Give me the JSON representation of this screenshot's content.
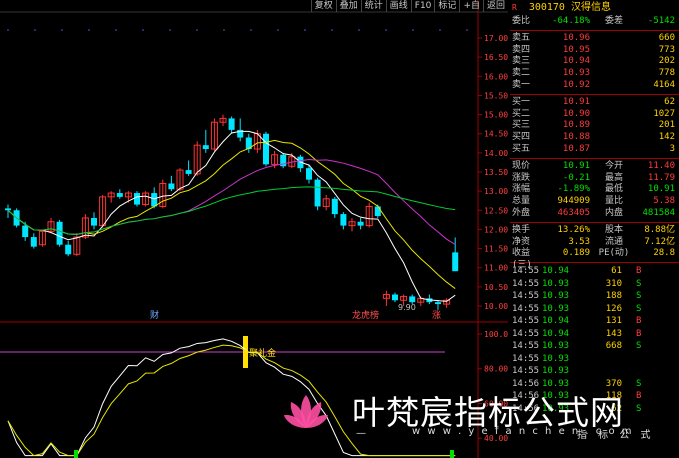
{
  "toolbar": [
    "复权",
    "叠加",
    "统计",
    "画线",
    "F10",
    "标记",
    "+自",
    "返回"
  ],
  "header": {
    "flag": "R",
    "code": "300170",
    "name": "汉得信息"
  },
  "order_book": {
    "webi": {
      "label": "委比",
      "value": "-64.18%",
      "label2": "委差",
      "value2": "-5142"
    },
    "asks": [
      {
        "label": "卖五",
        "price": "10.96",
        "vol": "660"
      },
      {
        "label": "卖四",
        "price": "10.95",
        "vol": "773"
      },
      {
        "label": "卖三",
        "price": "10.94",
        "vol": "202"
      },
      {
        "label": "卖二",
        "price": "10.93",
        "vol": "778"
      },
      {
        "label": "卖一",
        "price": "10.92",
        "vol": "4164"
      }
    ],
    "bids": [
      {
        "label": "买一",
        "price": "10.91",
        "vol": "62"
      },
      {
        "label": "买二",
        "price": "10.90",
        "vol": "1027"
      },
      {
        "label": "买三",
        "price": "10.89",
        "vol": "201"
      },
      {
        "label": "买四",
        "price": "10.88",
        "vol": "142"
      },
      {
        "label": "买五",
        "price": "10.87",
        "vol": "3"
      }
    ]
  },
  "stats": [
    {
      "l1": "现价",
      "v1": "10.91",
      "c1": "green",
      "l2": "今开",
      "v2": "11.40",
      "c2": "red"
    },
    {
      "l1": "涨跌",
      "v1": "-0.21",
      "c1": "green",
      "l2": "最高",
      "v2": "11.79",
      "c2": "red"
    },
    {
      "l1": "涨幅",
      "v1": "-1.89%",
      "c1": "green",
      "l2": "最低",
      "v2": "10.91",
      "c2": "green"
    },
    {
      "l1": "总量",
      "v1": "944909",
      "c1": "yel",
      "l2": "量比",
      "v2": "5.38",
      "c2": "red"
    },
    {
      "l1": "外盘",
      "v1": "463405",
      "c1": "red",
      "l2": "内盘",
      "v2": "481584",
      "c2": "green"
    }
  ],
  "fundamentals": [
    {
      "l1": "换手",
      "v1": "13.26%",
      "l2": "股本",
      "v2": "8.88亿"
    },
    {
      "l1": "净资",
      "v1": "3.53",
      "l2": "流通",
      "v2": "7.12亿"
    },
    {
      "l1": "收益(三)",
      "v1": "0.189",
      "l2": "PE(动)",
      "v2": "28.8"
    }
  ],
  "trades": [
    {
      "time": "14:55",
      "price": "10.94",
      "vol": "61",
      "bs": "B"
    },
    {
      "time": "14:55",
      "price": "10.93",
      "vol": "310",
      "bs": "S"
    },
    {
      "time": "14:55",
      "price": "10.93",
      "vol": "188",
      "bs": "S"
    },
    {
      "time": "14:55",
      "price": "10.93",
      "vol": "126",
      "bs": "S"
    },
    {
      "time": "14:55",
      "price": "10.94",
      "vol": "131",
      "bs": "B"
    },
    {
      "time": "14:55",
      "price": "10.94",
      "vol": "143",
      "bs": "B"
    },
    {
      "time": "14:55",
      "price": "10.93",
      "vol": "668",
      "bs": "S"
    },
    {
      "time": "14:55",
      "price": "10.93",
      "vol": "",
      "bs": ""
    },
    {
      "time": "14:55",
      "price": "10.93",
      "vol": "",
      "bs": ""
    },
    {
      "time": "14:56",
      "price": "10.93",
      "vol": "370",
      "bs": "S"
    },
    {
      "time": "14:56",
      "price": "10.93",
      "vol": "118",
      "bs": "B"
    },
    {
      "time": "14:56",
      "price": "10.93",
      "vol": "62",
      "bs": "S"
    }
  ],
  "chart_data": {
    "type": "candlestick",
    "price_axis_ticks": [
      "17.00",
      "16.50",
      "16.00",
      "15.50",
      "15.00",
      "14.50",
      "14.00",
      "13.50",
      "13.00",
      "12.50",
      "12.00",
      "11.50",
      "11.00",
      "10.50",
      "10.00"
    ],
    "ylim": [
      10.0,
      17.0
    ],
    "candles": [
      [
        12.55,
        12.65,
        12.3,
        12.5
      ],
      [
        12.5,
        12.55,
        12.05,
        12.1
      ],
      [
        12.1,
        12.2,
        11.7,
        11.8
      ],
      [
        11.8,
        11.9,
        11.5,
        11.55
      ],
      [
        11.6,
        12.0,
        11.55,
        11.95
      ],
      [
        11.95,
        12.3,
        11.9,
        12.2
      ],
      [
        12.2,
        12.25,
        11.55,
        11.6
      ],
      [
        11.6,
        11.7,
        11.3,
        11.35
      ],
      [
        11.35,
        11.9,
        11.3,
        11.8
      ],
      [
        11.8,
        12.4,
        11.75,
        12.3
      ],
      [
        12.3,
        12.45,
        12.0,
        12.1
      ],
      [
        12.1,
        12.9,
        12.05,
        12.85
      ],
      [
        12.85,
        13.0,
        12.7,
        12.95
      ],
      [
        12.95,
        13.05,
        12.8,
        12.85
      ],
      [
        12.85,
        13.0,
        12.7,
        12.95
      ],
      [
        12.95,
        13.0,
        12.6,
        12.65
      ],
      [
        12.65,
        13.0,
        12.6,
        12.95
      ],
      [
        12.95,
        13.1,
        12.55,
        12.6
      ],
      [
        12.6,
        13.3,
        12.55,
        13.2
      ],
      [
        13.2,
        13.4,
        13.0,
        13.05
      ],
      [
        13.05,
        13.6,
        13.0,
        13.55
      ],
      [
        13.55,
        13.8,
        13.4,
        13.45
      ],
      [
        13.45,
        14.3,
        13.4,
        14.2
      ],
      [
        14.2,
        14.6,
        14.0,
        14.1
      ],
      [
        14.1,
        14.9,
        14.05,
        14.8
      ],
      [
        14.8,
        15.0,
        14.7,
        14.9
      ],
      [
        14.9,
        14.95,
        14.5,
        14.6
      ],
      [
        14.6,
        14.9,
        14.3,
        14.4
      ],
      [
        14.4,
        14.5,
        14.0,
        14.1
      ],
      [
        14.1,
        14.6,
        14.0,
        14.5
      ],
      [
        14.5,
        14.55,
        13.65,
        13.7
      ],
      [
        13.7,
        14.05,
        13.6,
        13.95
      ],
      [
        13.95,
        14.0,
        13.6,
        13.65
      ],
      [
        13.65,
        14.0,
        13.6,
        13.9
      ],
      [
        13.9,
        13.95,
        13.5,
        13.6
      ],
      [
        13.6,
        13.7,
        13.2,
        13.3
      ],
      [
        13.3,
        13.35,
        12.5,
        12.6
      ],
      [
        12.6,
        12.9,
        12.5,
        12.8
      ],
      [
        12.8,
        12.85,
        12.3,
        12.4
      ],
      [
        12.4,
        12.45,
        12.0,
        12.1
      ],
      [
        12.1,
        12.3,
        11.95,
        12.2
      ],
      [
        12.2,
        12.3,
        12.0,
        12.1
      ],
      [
        12.1,
        12.7,
        12.05,
        12.6
      ],
      [
        12.6,
        12.65,
        12.3,
        12.35
      ],
      [
        10.2,
        10.4,
        10.0,
        10.3
      ],
      [
        10.3,
        10.35,
        10.1,
        10.15
      ],
      [
        10.15,
        10.3,
        10.0,
        10.25
      ],
      [
        10.25,
        10.3,
        10.05,
        10.1
      ],
      [
        10.1,
        10.25,
        10.0,
        10.2
      ],
      [
        10.2,
        10.3,
        10.05,
        10.1
      ],
      [
        10.1,
        10.15,
        9.9,
        10.05
      ],
      [
        10.05,
        10.2,
        9.95,
        10.15
      ],
      [
        11.4,
        11.79,
        10.91,
        10.91
      ]
    ],
    "annotations": [
      {
        "text": "财",
        "color": "#6fa8ff"
      },
      {
        "text": "龙虎榜",
        "color": "#ff4d4d"
      },
      {
        "text": "涨",
        "color": "#ff4d4d"
      },
      {
        "text": "9.90",
        "color": "#c0c0c0"
      }
    ],
    "indicator_axis_ticks": [
      "100.00",
      "80.00",
      "60.00",
      "40.00"
    ],
    "indicator_label": "聚礼金"
  },
  "watermark": {
    "title": "叶梵宸指标公式网",
    "url": "w w w . y e f a n c h e n . c o m",
    "dash": "—",
    "sub": "指 标 公 式",
    "brand": "#ff4fa3"
  },
  "colors": {
    "up": "#ff3333",
    "down": "#00e5ff",
    "ma_yellow": "#e6e600",
    "ma_white": "#ffffff",
    "ma_magenta": "#cc33cc",
    "ma_green": "#00cc33",
    "grid": "#a00000"
  }
}
